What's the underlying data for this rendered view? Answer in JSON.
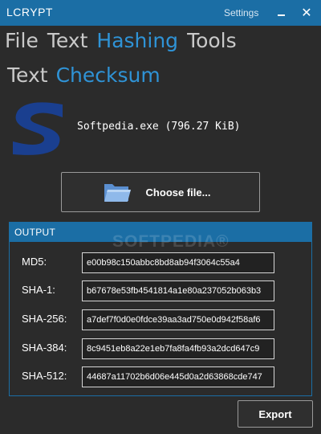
{
  "window": {
    "title": "LCRYPT",
    "settings_label": "Settings",
    "minimize_icon": "minimize-icon",
    "close_glyph": "✕"
  },
  "menu": {
    "items": [
      {
        "label": "File",
        "active": false
      },
      {
        "label": "Text",
        "active": false
      },
      {
        "label": "Hashing",
        "active": true
      },
      {
        "label": "Tools",
        "active": false
      }
    ]
  },
  "submenu": {
    "items": [
      {
        "label": "Text",
        "active": false
      },
      {
        "label": "Checksum",
        "active": true
      }
    ]
  },
  "file": {
    "logo_icon": "softpedia-s-logo",
    "name": "Softpedia.exe (796.27 KiB)"
  },
  "choose_button": {
    "label": "Choose file...",
    "icon": "folder-icon"
  },
  "output": {
    "header": "OUTPUT",
    "watermark": "SOFTPEDIA®",
    "rows": [
      {
        "label": "MD5:",
        "value": "e00b98c150abbc8bd8ab94f3064c55a4"
      },
      {
        "label": "SHA-1:",
        "value": "b67678e53fb4541814a1e80a237052b063b3"
      },
      {
        "label": "SHA-256:",
        "value": "a7def7f0d0e0fdce39aa3ad750e0d942f58af6"
      },
      {
        "label": "SHA-384:",
        "value": "8c9451eb8a22e1eb7fa8fa4fb93a2dcd647c9"
      },
      {
        "label": "SHA-512:",
        "value": "44687a11702b6d06e445d0a2d63868cde747"
      }
    ]
  },
  "export_button": {
    "label": "Export"
  },
  "colors": {
    "accent": "#1b6ea5",
    "active_text": "#2f93d6",
    "background": "#2b2b2b"
  }
}
